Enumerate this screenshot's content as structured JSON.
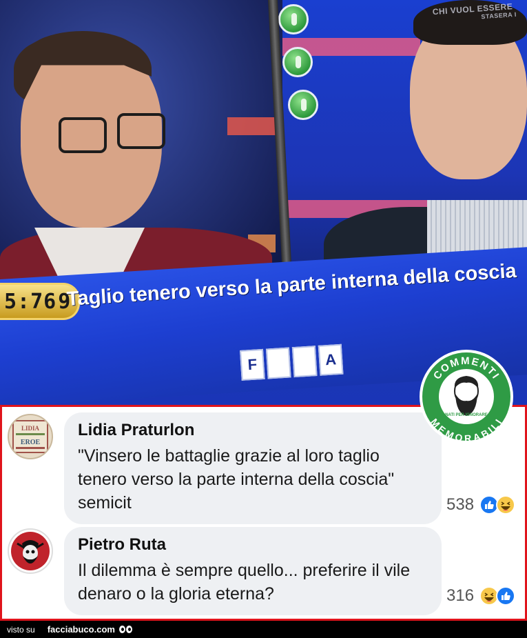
{
  "tv": {
    "timer": "5:76",
    "question": "Taglio tenero verso la parte interna della coscia",
    "tiles": [
      "F",
      "",
      "",
      "A"
    ],
    "watermark_line1": "CHI VUOL ESSERE",
    "watermark_line2": "STASERA I"
  },
  "badge": {
    "top_text": "COMMENTI",
    "bottom_text": "MEMORABILI",
    "small_text": "NATI PER IGNORARE"
  },
  "comments": [
    {
      "author": "Lidia Praturlon",
      "text": "\"Vinsero le battaglie grazie al loro taglio tenero verso la parte interna della coscia\" semicit",
      "count": "538",
      "avatar_label": "LIDIA",
      "avatar_sub": "EROE"
    },
    {
      "author": "Pietro Ruta",
      "text": "Il dilemma è sempre quello... preferire il vile denaro o la gloria eterna?",
      "count": "316"
    }
  ],
  "footer": {
    "visto": "visto su",
    "brand": "facciabuco.com"
  },
  "colors": {
    "frame_red": "#e0141c",
    "badge_green": "#2f9b45",
    "like_blue": "#1877f2",
    "bubble_bg": "#eef0f3"
  },
  "icons": [
    "lifeline-icon",
    "like-reaction-icon",
    "haha-reaction-icon",
    "eyes-icon"
  ]
}
